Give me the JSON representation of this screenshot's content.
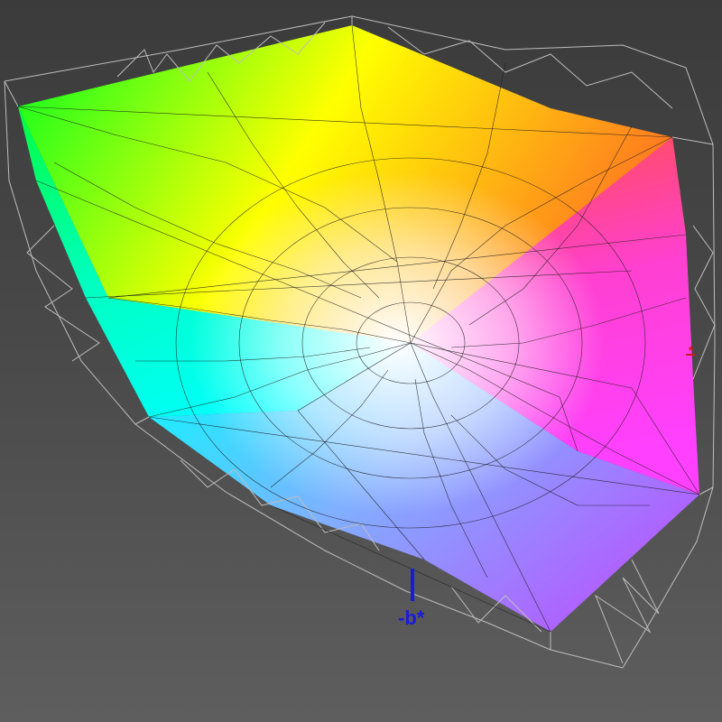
{
  "view": {
    "background": "#444444",
    "wireframe_outer_color": "#b8b8b8",
    "wireframe_inner_color": "#1c1c1c",
    "palette": {
      "green": "#00ff20",
      "yellow": "#ffff00",
      "orange": "#ff8a00",
      "red": "#ff3a2a",
      "magenta": "#ff30ff",
      "blue_violet": "#7a5cff",
      "cyan": "#00ffff",
      "spring": "#00ff90",
      "white": "#ffffff"
    }
  },
  "axes": {
    "b_neg": {
      "label": "-b*",
      "color": "#1a1adc"
    },
    "a_pos": {
      "label": "*",
      "color": "#d01818"
    }
  }
}
